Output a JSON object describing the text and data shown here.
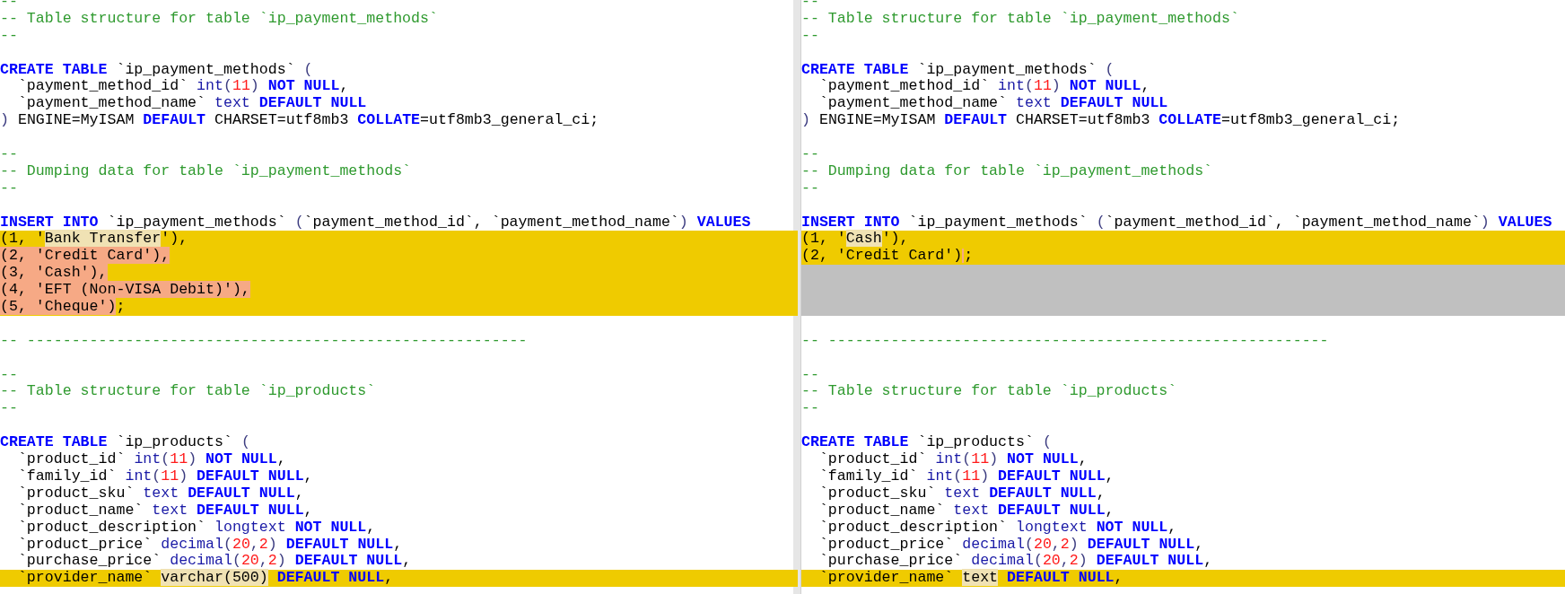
{
  "panes": [
    {
      "lines": [
        {
          "kind": "code",
          "changed": false,
          "tokens": [
            {
              "text": "--",
              "kind": "comment"
            }
          ]
        },
        {
          "kind": "code",
          "changed": false,
          "tokens": [
            {
              "text": "-- Table structure for table `ip_payment_methods`",
              "kind": "comment"
            }
          ]
        },
        {
          "kind": "code",
          "changed": false,
          "tokens": [
            {
              "text": "--",
              "kind": "comment"
            }
          ]
        },
        {
          "kind": "blank"
        },
        {
          "kind": "code",
          "changed": false,
          "tokens": [
            {
              "text": "CREATE TABLE",
              "kind": "keyword"
            },
            {
              "text": " `ip_payment_methods` ",
              "kind": "plain"
            },
            {
              "text": "(",
              "kind": "punct"
            }
          ]
        },
        {
          "kind": "code",
          "changed": false,
          "tokens": [
            {
              "text": "  `payment_method_id` ",
              "kind": "plain"
            },
            {
              "text": "int",
              "kind": "type"
            },
            {
              "text": "(",
              "kind": "punct"
            },
            {
              "text": "11",
              "kind": "number"
            },
            {
              "text": ") ",
              "kind": "punct"
            },
            {
              "text": "NOT NULL",
              "kind": "keyword"
            },
            {
              "text": ",",
              "kind": "plain"
            }
          ]
        },
        {
          "kind": "code",
          "changed": false,
          "tokens": [
            {
              "text": "  `payment_method_name` ",
              "kind": "plain"
            },
            {
              "text": "text ",
              "kind": "type"
            },
            {
              "text": "DEFAULT NULL",
              "kind": "keyword"
            }
          ]
        },
        {
          "kind": "code",
          "changed": false,
          "tokens": [
            {
              "text": ")",
              "kind": "punct"
            },
            {
              "text": " ENGINE=MyISAM ",
              "kind": "plain"
            },
            {
              "text": "DEFAULT",
              "kind": "keyword"
            },
            {
              "text": " CHARSET=utf8mb3 ",
              "kind": "plain"
            },
            {
              "text": "COLLATE",
              "kind": "keyword"
            },
            {
              "text": "=utf8mb3_general_ci;",
              "kind": "plain"
            }
          ]
        },
        {
          "kind": "blank"
        },
        {
          "kind": "code",
          "changed": false,
          "tokens": [
            {
              "text": "--",
              "kind": "comment"
            }
          ]
        },
        {
          "kind": "code",
          "changed": false,
          "tokens": [
            {
              "text": "-- Dumping data for table `ip_payment_methods`",
              "kind": "comment"
            }
          ]
        },
        {
          "kind": "code",
          "changed": false,
          "tokens": [
            {
              "text": "--",
              "kind": "comment"
            }
          ]
        },
        {
          "kind": "blank"
        },
        {
          "kind": "code",
          "changed": false,
          "tokens": [
            {
              "text": "INSERT INTO",
              "kind": "keyword"
            },
            {
              "text": " `ip_payment_methods` ",
              "kind": "plain"
            },
            {
              "text": "(",
              "kind": "punct"
            },
            {
              "text": "`payment_method_id`, `payment_method_name`",
              "kind": "plain"
            },
            {
              "text": ") ",
              "kind": "punct"
            },
            {
              "text": "VALUES",
              "kind": "keyword"
            }
          ]
        },
        {
          "kind": "code",
          "changed": true,
          "tokens": [
            {
              "text": "(1, '",
              "kind": "plain"
            },
            {
              "text": "Bank Transfer",
              "kind": "plain",
              "modified": true
            },
            {
              "text": "'),",
              "kind": "plain"
            }
          ]
        },
        {
          "kind": "code",
          "changed": true,
          "tokens": [
            {
              "text": "(2, 'Credit Card'),",
              "kind": "plain",
              "deleted": true
            }
          ]
        },
        {
          "kind": "code",
          "changed": true,
          "tokens": [
            {
              "text": "(3, 'Cash'),",
              "kind": "plain",
              "deleted": true
            }
          ]
        },
        {
          "kind": "code",
          "changed": true,
          "tokens": [
            {
              "text": "(4, 'EFT (Non-VISA Debit)'),",
              "kind": "plain",
              "deleted": true
            }
          ]
        },
        {
          "kind": "code",
          "changed": true,
          "tokens": [
            {
              "text": "(5, 'Cheque')",
              "kind": "plain",
              "deleted": true
            },
            {
              "text": ";",
              "kind": "plain"
            }
          ]
        },
        {
          "kind": "blank"
        },
        {
          "kind": "code",
          "changed": false,
          "tokens": [
            {
              "text": "-- --------------------------------------------------------",
              "kind": "comment"
            }
          ]
        },
        {
          "kind": "blank"
        },
        {
          "kind": "code",
          "changed": false,
          "tokens": [
            {
              "text": "--",
              "kind": "comment"
            }
          ]
        },
        {
          "kind": "code",
          "changed": false,
          "tokens": [
            {
              "text": "-- Table structure for table `ip_products`",
              "kind": "comment"
            }
          ]
        },
        {
          "kind": "code",
          "changed": false,
          "tokens": [
            {
              "text": "--",
              "kind": "comment"
            }
          ]
        },
        {
          "kind": "blank"
        },
        {
          "kind": "code",
          "changed": false,
          "tokens": [
            {
              "text": "CREATE TABLE",
              "kind": "keyword"
            },
            {
              "text": " `ip_products` ",
              "kind": "plain"
            },
            {
              "text": "(",
              "kind": "punct"
            }
          ]
        },
        {
          "kind": "code",
          "changed": false,
          "tokens": [
            {
              "text": "  `product_id` ",
              "kind": "plain"
            },
            {
              "text": "int",
              "kind": "type"
            },
            {
              "text": "(",
              "kind": "punct"
            },
            {
              "text": "11",
              "kind": "number"
            },
            {
              "text": ") ",
              "kind": "punct"
            },
            {
              "text": "NOT NULL",
              "kind": "keyword"
            },
            {
              "text": ",",
              "kind": "plain"
            }
          ]
        },
        {
          "kind": "code",
          "changed": false,
          "tokens": [
            {
              "text": "  `family_id` ",
              "kind": "plain"
            },
            {
              "text": "int",
              "kind": "type"
            },
            {
              "text": "(",
              "kind": "punct"
            },
            {
              "text": "11",
              "kind": "number"
            },
            {
              "text": ") ",
              "kind": "punct"
            },
            {
              "text": "DEFAULT NULL",
              "kind": "keyword"
            },
            {
              "text": ",",
              "kind": "plain"
            }
          ]
        },
        {
          "kind": "code",
          "changed": false,
          "tokens": [
            {
              "text": "  `product_sku` ",
              "kind": "plain"
            },
            {
              "text": "text ",
              "kind": "type"
            },
            {
              "text": "DEFAULT NULL",
              "kind": "keyword"
            },
            {
              "text": ",",
              "kind": "plain"
            }
          ]
        },
        {
          "kind": "code",
          "changed": false,
          "tokens": [
            {
              "text": "  `product_name` ",
              "kind": "plain"
            },
            {
              "text": "text ",
              "kind": "type"
            },
            {
              "text": "DEFAULT NULL",
              "kind": "keyword"
            },
            {
              "text": ",",
              "kind": "plain"
            }
          ]
        },
        {
          "kind": "code",
          "changed": false,
          "tokens": [
            {
              "text": "  `product_description` ",
              "kind": "plain"
            },
            {
              "text": "longtext ",
              "kind": "type"
            },
            {
              "text": "NOT NULL",
              "kind": "keyword"
            },
            {
              "text": ",",
              "kind": "plain"
            }
          ]
        },
        {
          "kind": "code",
          "changed": false,
          "tokens": [
            {
              "text": "  `product_price` ",
              "kind": "plain"
            },
            {
              "text": "decimal",
              "kind": "type"
            },
            {
              "text": "(",
              "kind": "punct"
            },
            {
              "text": "20",
              "kind": "number"
            },
            {
              "text": ",",
              "kind": "punct"
            },
            {
              "text": "2",
              "kind": "number"
            },
            {
              "text": ") ",
              "kind": "punct"
            },
            {
              "text": "DEFAULT NULL",
              "kind": "keyword"
            },
            {
              "text": ",",
              "kind": "plain"
            }
          ]
        },
        {
          "kind": "code",
          "changed": false,
          "tokens": [
            {
              "text": "  `purchase_price` ",
              "kind": "plain"
            },
            {
              "text": "decimal",
              "kind": "type"
            },
            {
              "text": "(",
              "kind": "punct"
            },
            {
              "text": "20",
              "kind": "number"
            },
            {
              "text": ",",
              "kind": "punct"
            },
            {
              "text": "2",
              "kind": "number"
            },
            {
              "text": ") ",
              "kind": "punct"
            },
            {
              "text": "DEFAULT NULL",
              "kind": "keyword"
            },
            {
              "text": ",",
              "kind": "plain"
            }
          ]
        },
        {
          "kind": "code",
          "changed": true,
          "tokens": [
            {
              "text": "  `provider_name` ",
              "kind": "plain"
            },
            {
              "text": "varchar(500)",
              "kind": "plain",
              "modified": true
            },
            {
              "text": " DEFAULT NULL",
              "kind": "keyword"
            },
            {
              "text": ",",
              "kind": "plain"
            }
          ]
        }
      ]
    },
    {
      "lines": [
        {
          "kind": "code",
          "changed": false,
          "tokens": [
            {
              "text": "--",
              "kind": "comment"
            }
          ]
        },
        {
          "kind": "code",
          "changed": false,
          "tokens": [
            {
              "text": "-- Table structure for table `ip_payment_methods`",
              "kind": "comment"
            }
          ]
        },
        {
          "kind": "code",
          "changed": false,
          "tokens": [
            {
              "text": "--",
              "kind": "comment"
            }
          ]
        },
        {
          "kind": "blank"
        },
        {
          "kind": "code",
          "changed": false,
          "tokens": [
            {
              "text": "CREATE TABLE",
              "kind": "keyword"
            },
            {
              "text": " `ip_payment_methods` ",
              "kind": "plain"
            },
            {
              "text": "(",
              "kind": "punct"
            }
          ]
        },
        {
          "kind": "code",
          "changed": false,
          "tokens": [
            {
              "text": "  `payment_method_id` ",
              "kind": "plain"
            },
            {
              "text": "int",
              "kind": "type"
            },
            {
              "text": "(",
              "kind": "punct"
            },
            {
              "text": "11",
              "kind": "number"
            },
            {
              "text": ") ",
              "kind": "punct"
            },
            {
              "text": "NOT NULL",
              "kind": "keyword"
            },
            {
              "text": ",",
              "kind": "plain"
            }
          ]
        },
        {
          "kind": "code",
          "changed": false,
          "tokens": [
            {
              "text": "  `payment_method_name` ",
              "kind": "plain"
            },
            {
              "text": "text ",
              "kind": "type"
            },
            {
              "text": "DEFAULT NULL",
              "kind": "keyword"
            }
          ]
        },
        {
          "kind": "code",
          "changed": false,
          "tokens": [
            {
              "text": ")",
              "kind": "punct"
            },
            {
              "text": " ENGINE=MyISAM ",
              "kind": "plain"
            },
            {
              "text": "DEFAULT",
              "kind": "keyword"
            },
            {
              "text": " CHARSET=utf8mb3 ",
              "kind": "plain"
            },
            {
              "text": "COLLATE",
              "kind": "keyword"
            },
            {
              "text": "=utf8mb3_general_ci;",
              "kind": "plain"
            }
          ]
        },
        {
          "kind": "blank"
        },
        {
          "kind": "code",
          "changed": false,
          "tokens": [
            {
              "text": "--",
              "kind": "comment"
            }
          ]
        },
        {
          "kind": "code",
          "changed": false,
          "tokens": [
            {
              "text": "-- Dumping data for table `ip_payment_methods`",
              "kind": "comment"
            }
          ]
        },
        {
          "kind": "code",
          "changed": false,
          "tokens": [
            {
              "text": "--",
              "kind": "comment"
            }
          ]
        },
        {
          "kind": "blank"
        },
        {
          "kind": "code",
          "changed": false,
          "tokens": [
            {
              "text": "INSERT INTO",
              "kind": "keyword"
            },
            {
              "text": " `ip_payment_methods` ",
              "kind": "plain"
            },
            {
              "text": "(",
              "kind": "punct"
            },
            {
              "text": "`payment_method_id`, `payment_method_name`",
              "kind": "plain"
            },
            {
              "text": ") ",
              "kind": "punct"
            },
            {
              "text": "VALUES",
              "kind": "keyword"
            }
          ]
        },
        {
          "kind": "code",
          "changed": true,
          "tokens": [
            {
              "text": "(1, '",
              "kind": "plain"
            },
            {
              "text": "Cash",
              "kind": "plain",
              "modified": true
            },
            {
              "text": "'),",
              "kind": "plain"
            }
          ]
        },
        {
          "kind": "code",
          "changed": true,
          "tokens": [
            {
              "text": "(2, 'Credit Card')",
              "kind": "plain"
            },
            {
              "kind": "gap"
            },
            {
              "text": ";",
              "kind": "plain"
            }
          ]
        },
        {
          "kind": "filler"
        },
        {
          "kind": "filler"
        },
        {
          "kind": "filler"
        },
        {
          "kind": "blank"
        },
        {
          "kind": "code",
          "changed": false,
          "tokens": [
            {
              "text": "-- --------------------------------------------------------",
              "kind": "comment"
            }
          ]
        },
        {
          "kind": "blank"
        },
        {
          "kind": "code",
          "changed": false,
          "tokens": [
            {
              "text": "--",
              "kind": "comment"
            }
          ]
        },
        {
          "kind": "code",
          "changed": false,
          "tokens": [
            {
              "text": "-- Table structure for table `ip_products`",
              "kind": "comment"
            }
          ]
        },
        {
          "kind": "code",
          "changed": false,
          "tokens": [
            {
              "text": "--",
              "kind": "comment"
            }
          ]
        },
        {
          "kind": "blank"
        },
        {
          "kind": "code",
          "changed": false,
          "tokens": [
            {
              "text": "CREATE TABLE",
              "kind": "keyword"
            },
            {
              "text": " `ip_products` ",
              "kind": "plain"
            },
            {
              "text": "(",
              "kind": "punct"
            }
          ]
        },
        {
          "kind": "code",
          "changed": false,
          "tokens": [
            {
              "text": "  `product_id` ",
              "kind": "plain"
            },
            {
              "text": "int",
              "kind": "type"
            },
            {
              "text": "(",
              "kind": "punct"
            },
            {
              "text": "11",
              "kind": "number"
            },
            {
              "text": ") ",
              "kind": "punct"
            },
            {
              "text": "NOT NULL",
              "kind": "keyword"
            },
            {
              "text": ",",
              "kind": "plain"
            }
          ]
        },
        {
          "kind": "code",
          "changed": false,
          "tokens": [
            {
              "text": "  `family_id` ",
              "kind": "plain"
            },
            {
              "text": "int",
              "kind": "type"
            },
            {
              "text": "(",
              "kind": "punct"
            },
            {
              "text": "11",
              "kind": "number"
            },
            {
              "text": ") ",
              "kind": "punct"
            },
            {
              "text": "DEFAULT NULL",
              "kind": "keyword"
            },
            {
              "text": ",",
              "kind": "plain"
            }
          ]
        },
        {
          "kind": "code",
          "changed": false,
          "tokens": [
            {
              "text": "  `product_sku` ",
              "kind": "plain"
            },
            {
              "text": "text ",
              "kind": "type"
            },
            {
              "text": "DEFAULT NULL",
              "kind": "keyword"
            },
            {
              "text": ",",
              "kind": "plain"
            }
          ]
        },
        {
          "kind": "code",
          "changed": false,
          "tokens": [
            {
              "text": "  `product_name` ",
              "kind": "plain"
            },
            {
              "text": "text ",
              "kind": "type"
            },
            {
              "text": "DEFAULT NULL",
              "kind": "keyword"
            },
            {
              "text": ",",
              "kind": "plain"
            }
          ]
        },
        {
          "kind": "code",
          "changed": false,
          "tokens": [
            {
              "text": "  `product_description` ",
              "kind": "plain"
            },
            {
              "text": "longtext ",
              "kind": "type"
            },
            {
              "text": "NOT NULL",
              "kind": "keyword"
            },
            {
              "text": ",",
              "kind": "plain"
            }
          ]
        },
        {
          "kind": "code",
          "changed": false,
          "tokens": [
            {
              "text": "  `product_price` ",
              "kind": "plain"
            },
            {
              "text": "decimal",
              "kind": "type"
            },
            {
              "text": "(",
              "kind": "punct"
            },
            {
              "text": "20",
              "kind": "number"
            },
            {
              "text": ",",
              "kind": "punct"
            },
            {
              "text": "2",
              "kind": "number"
            },
            {
              "text": ") ",
              "kind": "punct"
            },
            {
              "text": "DEFAULT NULL",
              "kind": "keyword"
            },
            {
              "text": ",",
              "kind": "plain"
            }
          ]
        },
        {
          "kind": "code",
          "changed": false,
          "tokens": [
            {
              "text": "  `purchase_price` ",
              "kind": "plain"
            },
            {
              "text": "decimal",
              "kind": "type"
            },
            {
              "text": "(",
              "kind": "punct"
            },
            {
              "text": "20",
              "kind": "number"
            },
            {
              "text": ",",
              "kind": "punct"
            },
            {
              "text": "2",
              "kind": "number"
            },
            {
              "text": ") ",
              "kind": "punct"
            },
            {
              "text": "DEFAULT NULL",
              "kind": "keyword"
            },
            {
              "text": ",",
              "kind": "plain"
            }
          ]
        },
        {
          "kind": "code",
          "changed": true,
          "tokens": [
            {
              "text": "  `provider_name` ",
              "kind": "plain"
            },
            {
              "text": "text",
              "kind": "plain",
              "modified": true
            },
            {
              "text": " DEFAULT NULL",
              "kind": "keyword"
            },
            {
              "text": ",",
              "kind": "plain"
            }
          ]
        }
      ]
    }
  ]
}
